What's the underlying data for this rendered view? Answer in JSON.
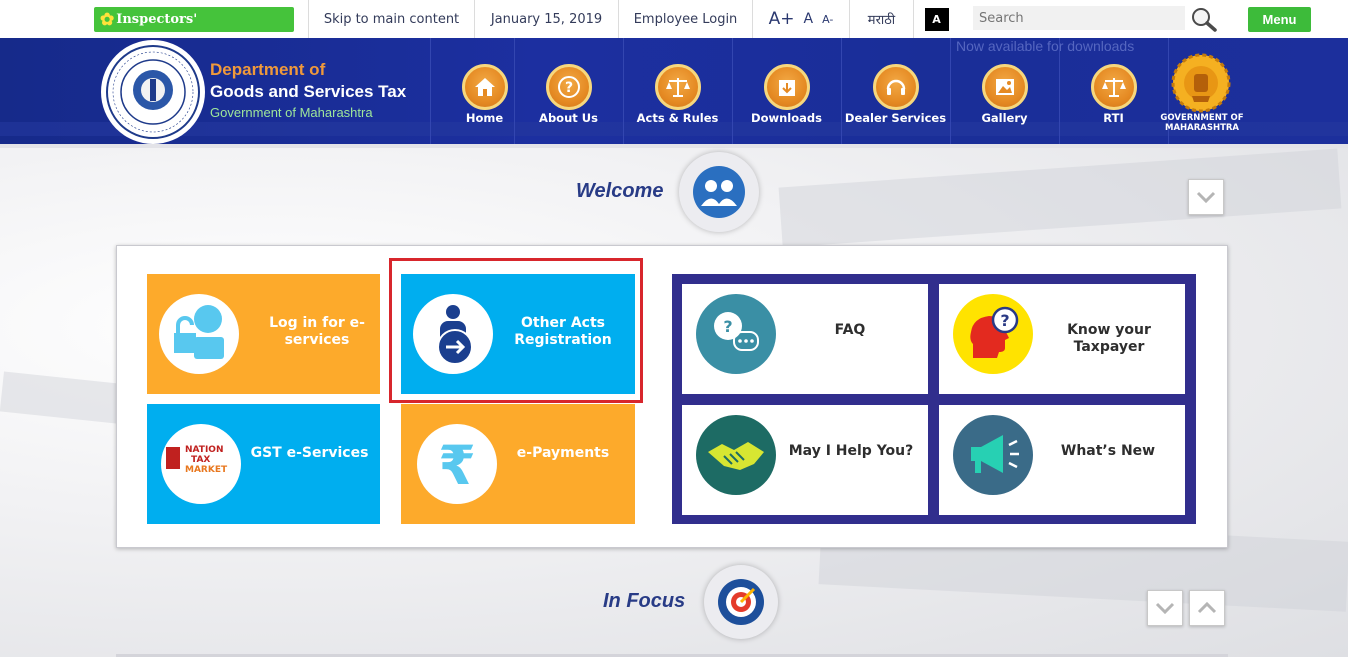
{
  "topbar": {
    "inspectors_label": "Inspectors'",
    "skip_label": "Skip to main content",
    "date": "January 15, 2019",
    "employee_login": "Employee Login",
    "font_large": "A+",
    "font_normal": "A",
    "font_small": "A-",
    "language": "मराठी",
    "contrast": "A",
    "search_placeholder": "Search",
    "menu_label": "Menu"
  },
  "header": {
    "ticker": "Now available for downloads",
    "title_line1": "Department of",
    "title_line2": "Goods and Services Tax",
    "title_line3": "Government of Maharashtra",
    "nav": [
      {
        "label": "Home",
        "icon": "home-icon"
      },
      {
        "label": "About Us",
        "icon": "question-icon"
      },
      {
        "label": "Acts & Rules",
        "icon": "scales-icon"
      },
      {
        "label": "Downloads",
        "icon": "download-icon"
      },
      {
        "label": "Dealer Services",
        "icon": "headset-icon"
      },
      {
        "label": "Gallery",
        "icon": "gallery-icon"
      },
      {
        "label": "RTI",
        "icon": "rti-scales-icon"
      }
    ],
    "gov_label_line1": "GOVERNMENT OF",
    "gov_label_line2": "MAHARASHTRA"
  },
  "welcome": {
    "title": "Welcome"
  },
  "tiles": {
    "login": "Log in for e-services",
    "other_acts": "Other Acts Registration",
    "gst_eservices": "GST e-Services",
    "gst_logo_line1": "NATION",
    "gst_logo_line2": "TAX",
    "gst_logo_line3": "MARKET",
    "epayments": "e-Payments",
    "faq": "FAQ",
    "know_taxpayer": "Know your Taxpayer",
    "help": "May I Help You?",
    "whats_new": "What’s New"
  },
  "in_focus": {
    "title": "In Focus"
  },
  "colors": {
    "orange_tile": "#fdaa2b",
    "blue_tile": "#00aeef",
    "header_blue": "#1c2f9c",
    "frame_navy": "#312e8d",
    "highlight_red": "#d8262c"
  }
}
